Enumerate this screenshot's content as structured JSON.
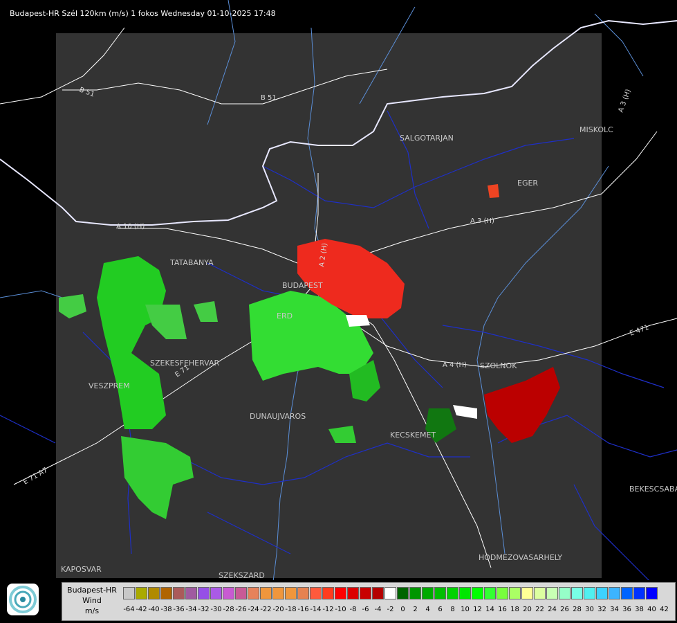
{
  "title": "Budapest-HR Szél 120km (m/s) 1 fokos Wednesday 01-10-2025 17:48",
  "colors": {
    "background": "#000000",
    "radar_area": "#333333",
    "border_line": "#ffffff",
    "county_line": "#1e2fc8",
    "river": "#5b8fd8",
    "road": "#ffffff"
  },
  "cities": [
    "SALGOTARJAN",
    "MISKOLC",
    "EGER",
    "TATABANYA",
    "BUDAPEST",
    "ERD",
    "SZEKESFEHERVAR",
    "VESZPREM",
    "DUNAUJVAROS",
    "KECSKEMET",
    "SZOLNOK",
    "BEKESCSABA",
    "HODMEZOVASARHELY",
    "KAPOSVAR",
    "SZEKSZARD"
  ],
  "roads": [
    "B 51",
    "B 51",
    "A 3 (H)",
    "A 3 (H)",
    "A 2 (H)",
    "A 10 (H)",
    "E 71",
    "A 4 (H)",
    "E 471",
    "E 71 A7"
  ],
  "legend": {
    "title_line1": "Budapest-HR",
    "title_line2": "Wind",
    "title_line3": "m/s",
    "colors": [
      "#c8c8c8",
      "#aaaa00",
      "#b08a00",
      "#b06400",
      "#aa5a5a",
      "#a05aa0",
      "#9650e6",
      "#aa5ae6",
      "#c85ad2",
      "#c85a96",
      "#e6825a",
      "#f0963c",
      "#f0963c",
      "#f0963c",
      "#e68250",
      "#ff5a3c",
      "#ff3c1e",
      "#ff0000",
      "#dc0000",
      "#c80000",
      "#b40000",
      "#ffffff",
      "#006400",
      "#009600",
      "#00aa00",
      "#00be00",
      "#00d200",
      "#00e600",
      "#00ff00",
      "#32ff32",
      "#78ff3c",
      "#aaff64",
      "#ffff96",
      "#dcffa0",
      "#c8ffb4",
      "#96ffc8",
      "#78ffe6",
      "#50f0f0",
      "#3cd2ff",
      "#3cb4ff",
      "#0064ff",
      "#0032ff",
      "#0000ff"
    ],
    "labels": [
      "-64",
      "-42",
      "-40",
      "-38",
      "-36",
      "-34",
      "-32",
      "-30",
      "-28",
      "-26",
      "-24",
      "-22",
      "-20",
      "-18",
      "-16",
      "-14",
      "-12",
      "-10",
      "-8",
      "-6",
      "-4",
      "-2",
      "0",
      "2",
      "4",
      "6",
      "8",
      "10",
      "12",
      "14",
      "16",
      "18",
      "20",
      "22",
      "24",
      "26",
      "28",
      "30",
      "32",
      "34",
      "36",
      "38",
      "40",
      "42"
    ]
  }
}
